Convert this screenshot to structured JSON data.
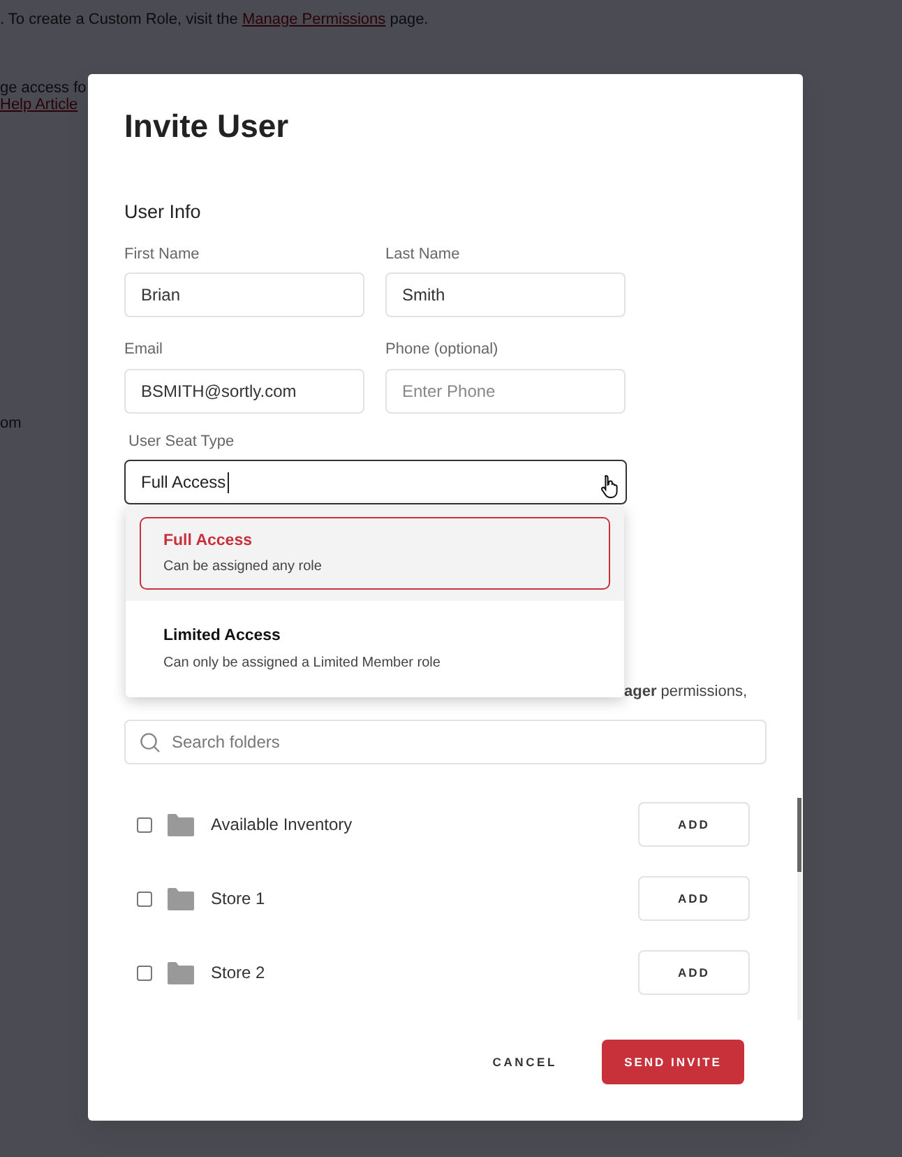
{
  "background": {
    "notice": {
      "before": ". To create a Custom Role, visit the ",
      "link": "Manage Permissions",
      "after": " page."
    },
    "fragments": [
      {
        "kind": "text",
        "text": "ge access fo"
      },
      {
        "kind": "link",
        "text": "Help Article"
      },
      {
        "kind": "text",
        "text": "om"
      }
    ]
  },
  "modal": {
    "title": "Invite User",
    "section": "User Info",
    "fields": [
      {
        "label": "First Name",
        "value": "Brian"
      },
      {
        "label": "Last Name",
        "value": "Smith"
      },
      {
        "label": "Email",
        "value": "BSMITH@sortly.com"
      },
      {
        "label": "Phone (optional)",
        "placeholder": "Enter Phone"
      }
    ],
    "seat_type": {
      "label": "User Seat Type",
      "value": "Full Access",
      "expanded": true
    },
    "options": [
      {
        "title": "Full Access",
        "description": "Can be assigned any role",
        "selected": true
      },
      {
        "title": "Limited Access",
        "description": "Can only be assigned a Limited Member role",
        "selected": false
      }
    ],
    "partial_text": "**ager** permissions,",
    "search": {
      "placeholder": "Search folders"
    },
    "folders": [
      {
        "name": "Available Inventory",
        "checked": false,
        "button": "ADD"
      },
      {
        "name": "Store 1",
        "checked": false,
        "button": "ADD"
      },
      {
        "name": "Store 2",
        "checked": false,
        "button": "ADD"
      }
    ],
    "buttons": [
      {
        "kind": "secondary",
        "label": "CANCEL"
      },
      {
        "kind": "primary",
        "label": "SEND INVITE"
      }
    ]
  }
}
